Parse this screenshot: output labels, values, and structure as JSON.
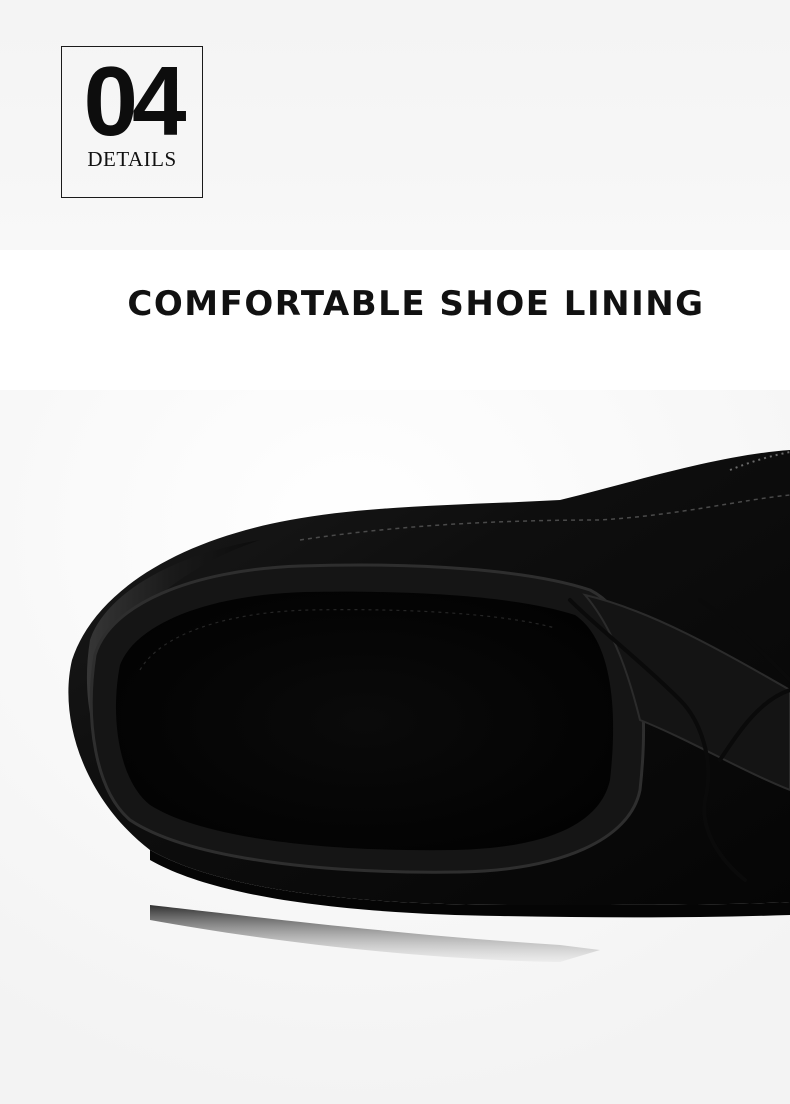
{
  "details_badge": {
    "number": "04",
    "label": "DETAILS"
  },
  "headline": "COMFORTABLE SHOE LINING",
  "photo": {
    "subject": "shoe-photo"
  },
  "colors": {
    "text": "#111111",
    "top_band": "#f5f5f5",
    "shoe": "#0b0b0b"
  }
}
